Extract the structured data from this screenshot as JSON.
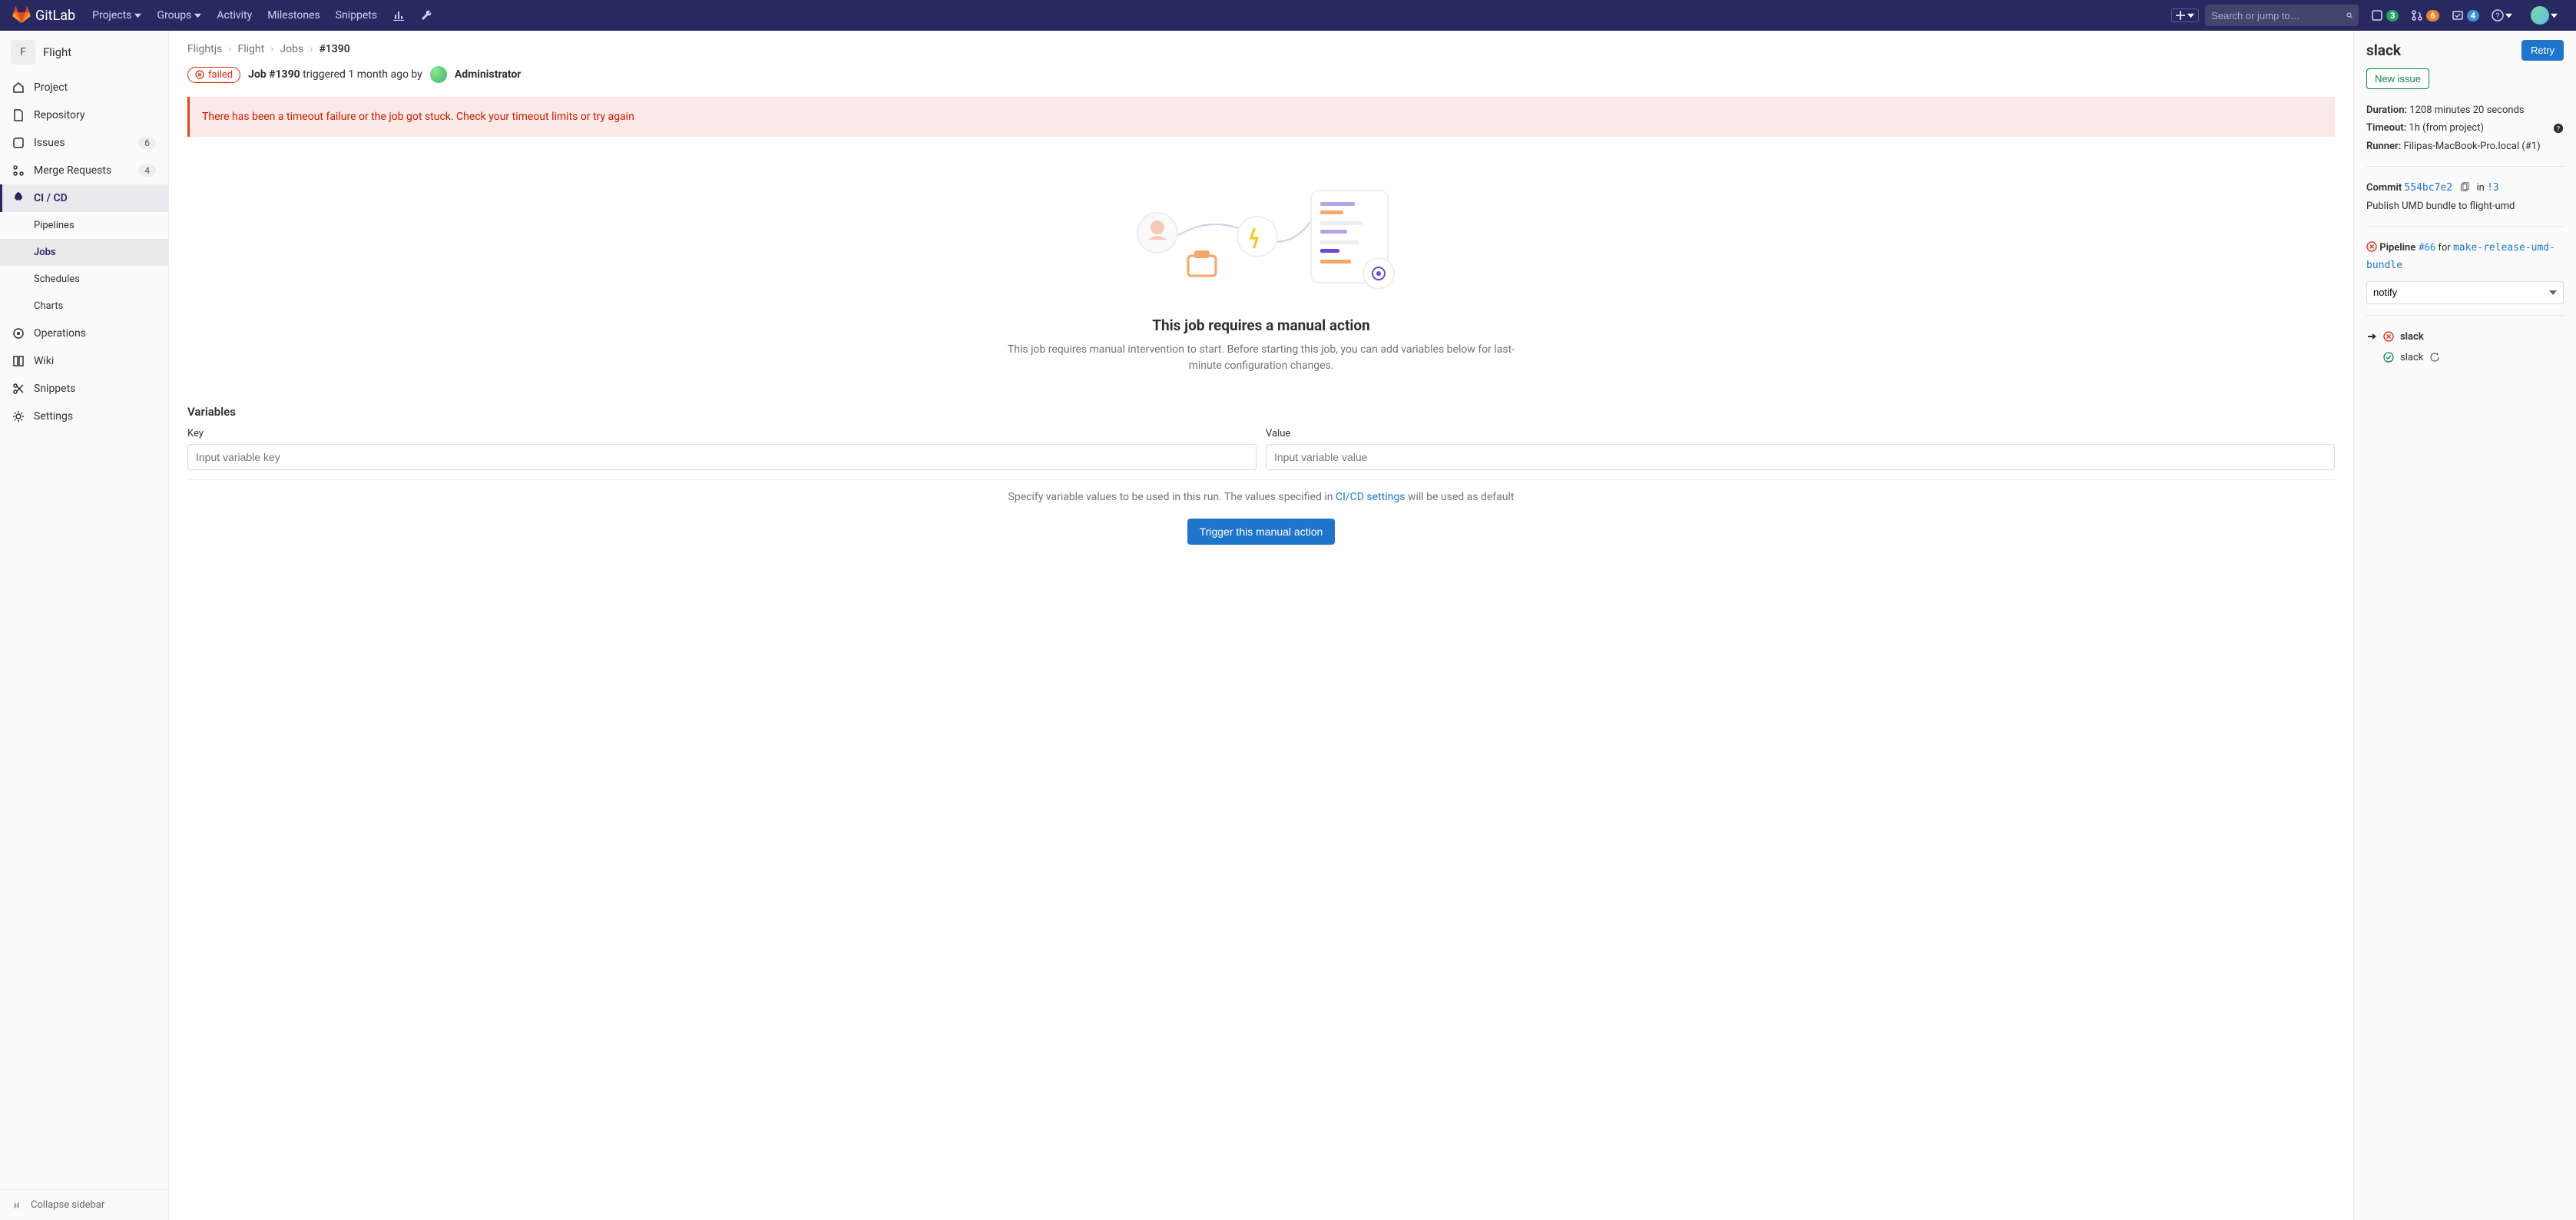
{
  "nav": {
    "brand": "GitLab",
    "items": [
      "Projects",
      "Groups",
      "Activity",
      "Milestones",
      "Snippets"
    ],
    "search_placeholder": "Search or jump to…",
    "badge_issues": "3",
    "badge_mr": "6",
    "badge_todo": "4"
  },
  "project": {
    "initial": "F",
    "name": "Flight"
  },
  "sidebar": {
    "items": [
      {
        "label": "Project"
      },
      {
        "label": "Repository"
      },
      {
        "label": "Issues",
        "count": "6"
      },
      {
        "label": "Merge Requests",
        "count": "4"
      },
      {
        "label": "CI / CD"
      },
      {
        "label": "Operations"
      },
      {
        "label": "Wiki"
      },
      {
        "label": "Snippets"
      },
      {
        "label": "Settings"
      }
    ],
    "ci_sub": [
      "Pipelines",
      "Jobs",
      "Schedules",
      "Charts"
    ],
    "collapse": "Collapse sidebar"
  },
  "crumbs": {
    "a": "Flightjs",
    "b": "Flight",
    "c": "Jobs",
    "d": "#1390"
  },
  "job": {
    "status": "failed",
    "title": "Job #1390",
    "trig_text": " triggered 1 month ago by ",
    "user": "Administrator"
  },
  "alert": "There has been a timeout failure or the job got stuck. Check your timeout limits or try again",
  "empty": {
    "title": "This job requires a manual action",
    "body": "This job requires manual intervention to start. Before starting this job, you can add variables below for last-minute configuration changes."
  },
  "vars": {
    "heading": "Variables",
    "key_label": "Key",
    "val_label": "Value",
    "key_ph": "Input variable key",
    "val_ph": "Input variable value",
    "help_a": "Specify variable values to be used in this run. The values specified in ",
    "help_link": "CI/CD settings",
    "help_b": " will be used as default",
    "trigger": "Trigger this manual action"
  },
  "rside": {
    "title": "slack",
    "retry": "Retry",
    "newissue": "New issue",
    "duration_l": "Duration:",
    "duration_v": " 1208 minutes 20 seconds",
    "timeout_l": "Timeout:",
    "timeout_v": " 1h (from project)",
    "runner_l": "Runner:",
    "runner_v": " Filipas-MacBook-Pro.local (#1)",
    "commit_l": "Commit ",
    "commit_sha": "554bc7e2",
    "commit_in": " in ",
    "commit_mr": "!3",
    "commit_msg": "Publish UMD bundle to flight-umd",
    "pipeline_l": "Pipeline ",
    "pipeline_id": "#66",
    "pipeline_for": " for ",
    "pipeline_branch": "make-release-umd-bundle",
    "stage": "notify",
    "job_current": "slack",
    "job_other": "slack"
  }
}
